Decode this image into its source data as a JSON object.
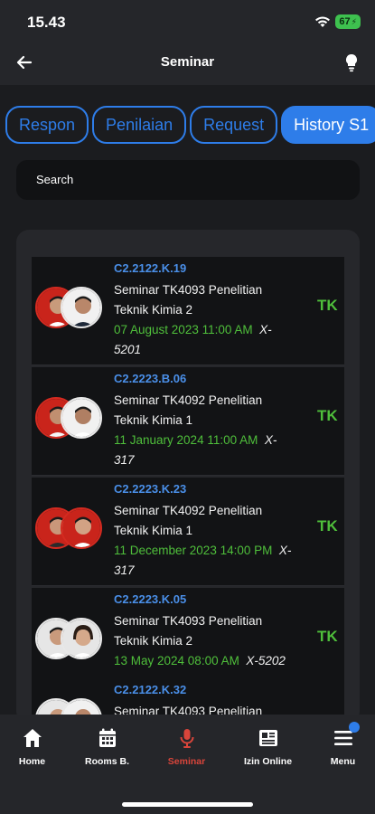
{
  "status_bar": {
    "time": "15.43",
    "battery": "67"
  },
  "app_bar": {
    "title": "Seminar",
    "back_icon": "arrow-left-icon",
    "action_icon": "lightbulb-icon"
  },
  "tabs": [
    {
      "label": "Respon",
      "active": false
    },
    {
      "label": "Penilaian",
      "active": false
    },
    {
      "label": "Request",
      "active": false
    },
    {
      "label": "History S1",
      "active": true
    }
  ],
  "search": {
    "placeholder": "Search"
  },
  "seminars": [
    {
      "code": "C2.2122.K.19",
      "title": "Seminar TK4093 Penelitian Teknik Kimia 2",
      "date": "07 August 2023 11:00 AM",
      "room": "X-5201",
      "badge": "TK"
    },
    {
      "code": "C2.2223.B.06",
      "title": "Seminar TK4092 Penelitian Teknik Kimia 1",
      "date": "11 January 2024 11:00 AM",
      "room": "X-317",
      "badge": "TK"
    },
    {
      "code": "C2.2223.K.23",
      "title": "Seminar TK4092 Penelitian Teknik Kimia 1",
      "date": "11 December 2023 14:00 PM",
      "room": "X-317",
      "badge": "TK"
    },
    {
      "code": "C2.2223.K.05",
      "title": "Seminar TK4093 Penelitian Teknik Kimia 2",
      "date": "13 May 2024 08:00 AM",
      "room": "X-5202",
      "badge": "TK"
    },
    {
      "code": "C2.2122.K.32",
      "title": "Seminar TK4093 Penelitian",
      "date": "",
      "room": "",
      "badge": ""
    }
  ],
  "bottom_nav": [
    {
      "label": "Home",
      "icon": "home-icon",
      "active": false
    },
    {
      "label": "Rooms B.",
      "icon": "calendar-icon",
      "active": false
    },
    {
      "label": "Seminar",
      "icon": "microphone-icon",
      "active": true
    },
    {
      "label": "Izin Online",
      "icon": "document-icon",
      "active": false
    },
    {
      "label": "Menu",
      "icon": "menu-icon",
      "active": false
    }
  ],
  "colors": {
    "accent": "#2e7de9",
    "code": "#4a8fe8",
    "date": "#4fbf3b",
    "active_nav": "#d9453b",
    "background": "#1b1c1f"
  }
}
